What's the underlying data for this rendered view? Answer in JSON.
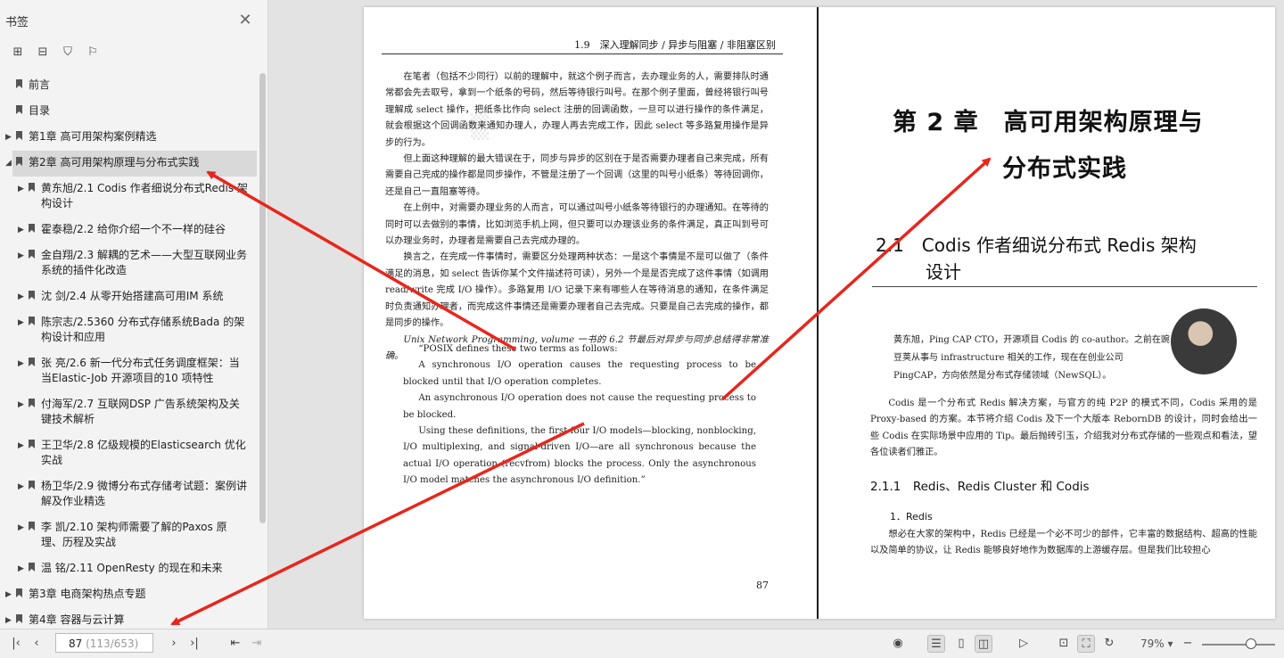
{
  "sidebar": {
    "title": "书签",
    "close_icon": "close-icon",
    "tools": [
      "expand-all-icon",
      "collapse-all-icon",
      "add-bookmark-icon",
      "bookmark-icon"
    ],
    "items": [
      {
        "label": "前言",
        "level": 0,
        "expandable": false
      },
      {
        "label": "目录",
        "level": 0,
        "expandable": false
      },
      {
        "label": "第1章 高可用架构案例精选",
        "level": 0,
        "expandable": true,
        "expanded": false
      },
      {
        "label": "第2章 高可用架构原理与分布式实践",
        "level": 0,
        "expandable": true,
        "expanded": true,
        "selected": true
      },
      {
        "label": "黄东旭/2.1 Codis 作者细说分布式Redis 架构设计",
        "level": 1,
        "expandable": true
      },
      {
        "label": "霍泰稳/2.2 给你介绍一个不一样的硅谷",
        "level": 1,
        "expandable": true
      },
      {
        "label": "金自翔/2.3 解耦的艺术——大型互联网业务系统的插件化改造",
        "level": 1,
        "expandable": true
      },
      {
        "label": "沈 剑/2.4 从零开始搭建高可用IM 系统",
        "level": 1,
        "expandable": true
      },
      {
        "label": "陈宗志/2.5360 分布式存储系统Bada 的架构设计和应用",
        "level": 1,
        "expandable": true
      },
      {
        "label": "张 亮/2.6 新一代分布式任务调度框架：当当Elastic-Job 开源项目的10 项特性",
        "level": 1,
        "expandable": true
      },
      {
        "label": "付海军/2.7 互联网DSP 广告系统架构及关键技术解析",
        "level": 1,
        "expandable": true
      },
      {
        "label": "王卫华/2.8 亿级规模的Elasticsearch 优化实战",
        "level": 1,
        "expandable": true
      },
      {
        "label": "杨卫华/2.9 微博分布式存储考试题：案例讲解及作业精选",
        "level": 1,
        "expandable": true
      },
      {
        "label": "李 凯/2.10 架构师需要了解的Paxos 原理、历程及实战",
        "level": 1,
        "expandable": true
      },
      {
        "label": "温 铭/2.11 OpenResty 的现在和未来",
        "level": 1,
        "expandable": true
      },
      {
        "label": "第3章 电商架构热点专题",
        "level": 0,
        "expandable": true
      },
      {
        "label": "第4章 容器与云计算",
        "level": 0,
        "expandable": true
      }
    ]
  },
  "left_page": {
    "running_head": "1.9　深入理解同步 / 异步与阻塞 / 非阻塞区别",
    "paragraphs": [
      "在笔者（包括不少同行）以前的理解中，就这个例子而言，去办理业务的人，需要排队时通常都会先去取号，拿到一个纸条的号码，然后等待银行叫号。在那个例子里面，曾经将银行叫号理解成 select 操作，把纸条比作向 select 注册的回调函数，一旦可以进行操作的条件满足，就会根据这个回调函数来通知办理人，办理人再去完成工作，因此 select 等多路复用操作是异步的行为。",
      "但上面这种理解的最大错误在于，同步与异步的区别在于是否需要办理者自己来完成，所有需要自己完成的操作都是同步操作，不管是注册了一个回调（这里的叫号小纸条）等待回调你，还是自己一直阻塞等待。",
      "在上例中，对需要办理业务的人而言，可以通过叫号小纸条等待银行的办理通知。在等待的同时可以去做别的事情，比如浏览手机上网，但只要可以办理该业务的条件满足，真正叫到号可以办理业务时，办理者是需要自己去完成办理的。",
      "换言之，在完成一件事情时，需要区分处理两种状态：一是这个事情是不是可以做了（条件满足的消息，如 select 告诉你某个文件描述符可读），另外一个是是否完成了这件事情（如调用 read/write 完成 I/O 操作）。多路复用 I/O 记录下来有哪些人在等待消息的通知，在条件满足时负责通知办理者，而完成这件事情还是需要办理者自己去完成。只要是自己去完成的操作，都是同步的操作。",
      "Unix Network Programming, volume 一书的 6.2 节最后对异步与同步总结得非常准确。"
    ],
    "quote": [
      "“POSIX defines these two terms as follows:",
      "A synchronous I/O operation causes the requesting process to be blocked until that I/O operation completes.",
      "An asynchronous I/O operation does not cause the requesting process to be blocked.",
      "Using these definitions, the first four I/O models—blocking, nonblocking, I/O multiplexing, and signal-driven I/O—are all synchronous because the actual I/O operation (recvfrom) blocks the process. Only the asynchronous I/O model matches the asynchronous I/O definition.”"
    ],
    "page_number": "87"
  },
  "right_page": {
    "chapter_title_line1": "第 2 章　高可用架构原理与",
    "chapter_title_line2": "分布式实践",
    "section_title_line1": "2.1　Codis 作者细说分布式 Redis 架构",
    "section_title_line2": "设计",
    "author_intro": "黄东旭，Ping CAP CTO，开源项目 Codis 的 co-author。之前在豌豆荚从事与 infrastructure 相关的工作，现在在创业公司 PingCAP，方向依然是分布式存储领域（NewSQL）。",
    "intro_paragraph": "Codis 是一个分布式 Redis 解决方案，与官方的纯 P2P 的模式不同，Codis 采用的是 Proxy-based 的方案。本节将介绍 Codis 及下一个大版本 RebornDB 的设计，同时会给出一些 Codis 在实际场景中应用的 Tip。最后抛砖引玉，介绍我对分布式存储的一些观点和看法，望各位读者们雅正。",
    "subsection_title": "2.1.1　Redis、Redis Cluster 和 Codis",
    "subsubsection_title": "1．Redis",
    "redis_paragraph": "想必在大家的架构中，Redis 已经是一个必不可少的部件，它丰富的数据结构、超高的性能以及简单的协议，让 Redis 能够良好地作为数据库的上游缓存层。但是我们比较担心"
  },
  "statusbar": {
    "page_current": "87",
    "page_total": "(113/653)",
    "zoom": "79%",
    "zoom_level": 0.79
  },
  "annotation_color": "#e8261c"
}
